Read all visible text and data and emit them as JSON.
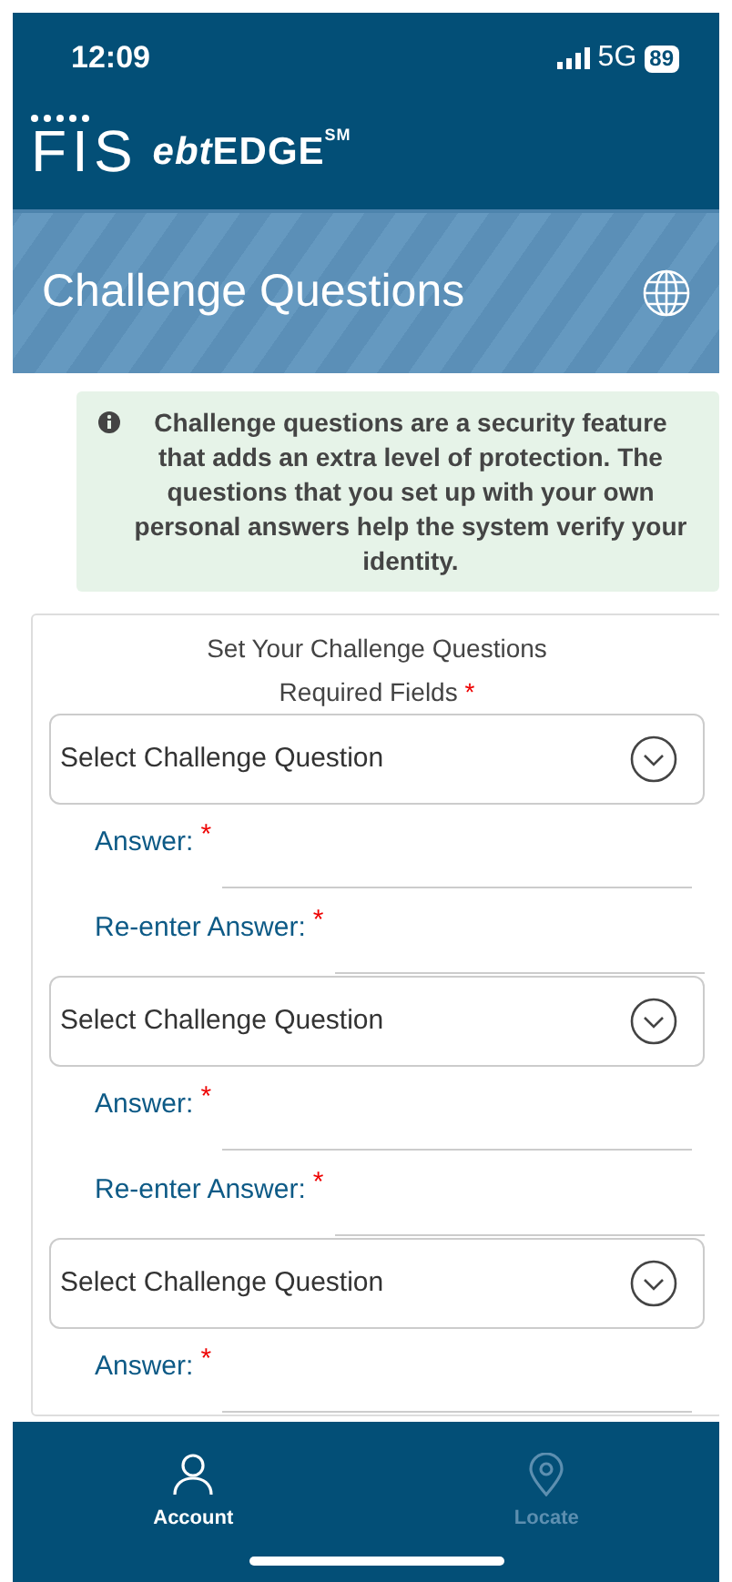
{
  "status_bar": {
    "time": "12:09",
    "network": "5G",
    "battery": "89"
  },
  "header": {
    "logo": "FIS",
    "brand_prefix": "ebt",
    "brand_name": "EDGE",
    "service_mark": "SM"
  },
  "page_title": "Challenge Questions",
  "info": {
    "text": "Challenge questions are a security feature that adds an extra level of protection. The questions that you set up with your own personal answers help the system verify your identity."
  },
  "form": {
    "title": "Set Your Challenge Questions",
    "required_label": "Required Fields",
    "required_mark": "*",
    "fields": [
      {
        "kind": "select",
        "placeholder": "Select Challenge Question"
      },
      {
        "kind": "text",
        "label": "Answer:",
        "required_mark": "*"
      },
      {
        "kind": "text",
        "label": "Re-enter Answer:",
        "required_mark": "*"
      },
      {
        "kind": "select",
        "placeholder": "Select Challenge Question"
      },
      {
        "kind": "text",
        "label": "Answer:",
        "required_mark": "*"
      },
      {
        "kind": "text",
        "label": "Re-enter Answer:",
        "required_mark": "*"
      },
      {
        "kind": "select",
        "placeholder": "Select Challenge Question"
      },
      {
        "kind": "text",
        "label": "Answer:",
        "required_mark": "*"
      }
    ]
  },
  "nav": [
    {
      "kind": "account",
      "label": "Account",
      "selected": true
    },
    {
      "kind": "locate",
      "label": "Locate",
      "selected": false
    }
  ]
}
